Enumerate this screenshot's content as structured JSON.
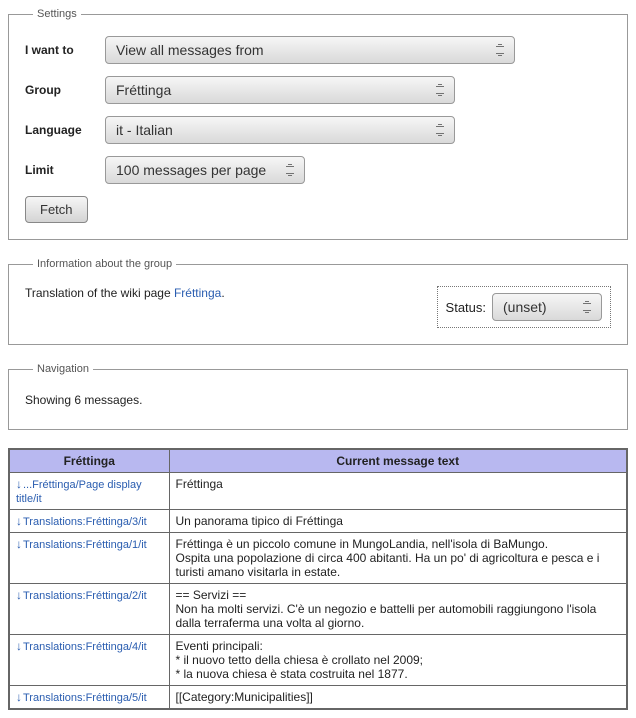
{
  "settings": {
    "legend": "Settings",
    "rows": {
      "action": {
        "label": "I want to",
        "value": "View all messages from"
      },
      "group": {
        "label": "Group",
        "value": "Fréttinga"
      },
      "lang": {
        "label": "Language",
        "value": "it - Italian"
      },
      "limit": {
        "label": "Limit",
        "value": "100 messages per page"
      }
    },
    "fetch": "Fetch"
  },
  "info": {
    "legend": "Information about the group",
    "prefix": "Translation of the wiki page ",
    "page_link": "Fréttinga",
    "suffix": ".",
    "status_label": "Status:",
    "status_value": "(unset)"
  },
  "nav": {
    "legend": "Navigation",
    "text": "Showing 6 messages."
  },
  "table": {
    "col_key": "Fréttinga",
    "col_msg": "Current message text",
    "rows": [
      {
        "link": "...Fréttinga/Page display title/it",
        "msg": "Fréttinga"
      },
      {
        "link": "Translations:Fréttinga/3/it",
        "msg": "Un panorama tipico di Fréttinga"
      },
      {
        "link": "Translations:Fréttinga/1/it",
        "msg": "Fréttinga è un piccolo comune in MungoLandia, nell'isola di BaMungo.\nOspita una popolazione di circa 400 abitanti. Ha un po' di agricoltura e pesca e i turisti amano visitarla in estate."
      },
      {
        "link": "Translations:Fréttinga/2/it",
        "msg": "== Servizi ==\nNon ha molti servizi. C'è un negozio e battelli per automobili raggiungono l'isola dalla terraferma una volta al giorno."
      },
      {
        "link": "Translations:Fréttinga/4/it",
        "msg": "Eventi principali:\n* il nuovo tetto della chiesa è crollato nel 2009;\n* la nuova chiesa è stata costruita nel 1877."
      },
      {
        "link": "Translations:Fréttinga/5/it",
        "msg": "[[Category:Municipalities]]"
      }
    ]
  }
}
